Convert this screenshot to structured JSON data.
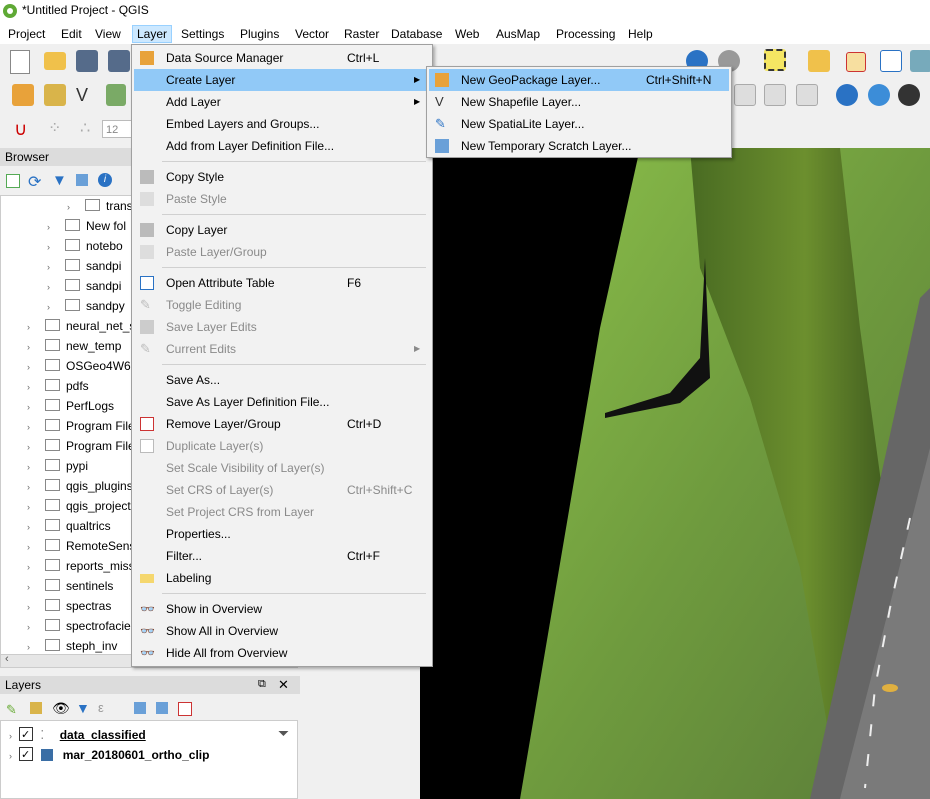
{
  "window": {
    "title": "*Untitled Project - QGIS"
  },
  "menubar": [
    "Project",
    "Edit",
    "View",
    "Layer",
    "Settings",
    "Plugins",
    "Vector",
    "Raster",
    "Database",
    "Web",
    "AusMap",
    "Processing",
    "Help"
  ],
  "toolbar": {
    "scale_value": "12"
  },
  "browser": {
    "title": "Browser",
    "items": [
      "trans",
      "New fol",
      "notebo",
      "sandpi",
      "sandpi",
      "sandpy",
      "neural_net_s",
      "new_temp",
      "OSGeo4W64",
      "pdfs",
      "PerfLogs",
      "Program File",
      "Program File",
      "pypi",
      "qgis_plugins",
      "qgis_project",
      "qualtrics",
      "RemoteSens",
      "reports_miss",
      "sentinels",
      "spectras",
      "spectrofacie",
      "steph_inv"
    ]
  },
  "layers": {
    "title": "Layers",
    "items": [
      "data_classified",
      "mar_20180601_ortho_clip"
    ]
  },
  "layer_menu": {
    "items": [
      {
        "label": "Data Source Manager",
        "shortcut": "Ctrl+L"
      },
      {
        "label": "Create Layer",
        "shortcut": ""
      },
      {
        "label": "Add Layer",
        "shortcut": ""
      },
      {
        "label": "Embed Layers and Groups...",
        "shortcut": ""
      },
      {
        "label": "Add from Layer Definition File...",
        "shortcut": ""
      },
      {
        "label": "Copy Style",
        "shortcut": ""
      },
      {
        "label": "Paste Style",
        "shortcut": ""
      },
      {
        "label": "Copy Layer",
        "shortcut": ""
      },
      {
        "label": "Paste Layer/Group",
        "shortcut": ""
      },
      {
        "label": "Open Attribute Table",
        "shortcut": "F6"
      },
      {
        "label": "Toggle Editing",
        "shortcut": ""
      },
      {
        "label": "Save Layer Edits",
        "shortcut": ""
      },
      {
        "label": "Current Edits",
        "shortcut": ""
      },
      {
        "label": "Save As...",
        "shortcut": ""
      },
      {
        "label": "Save As Layer Definition File...",
        "shortcut": ""
      },
      {
        "label": "Remove Layer/Group",
        "shortcut": "Ctrl+D"
      },
      {
        "label": "Duplicate Layer(s)",
        "shortcut": ""
      },
      {
        "label": "Set Scale Visibility of Layer(s)",
        "shortcut": ""
      },
      {
        "label": "Set CRS of Layer(s)",
        "shortcut": "Ctrl+Shift+C"
      },
      {
        "label": "Set Project CRS from Layer",
        "shortcut": ""
      },
      {
        "label": "Properties...",
        "shortcut": ""
      },
      {
        "label": "Filter...",
        "shortcut": "Ctrl+F"
      },
      {
        "label": "Labeling",
        "shortcut": ""
      },
      {
        "label": "Show in Overview",
        "shortcut": ""
      },
      {
        "label": "Show All in Overview",
        "shortcut": ""
      },
      {
        "label": "Hide All from Overview",
        "shortcut": ""
      }
    ]
  },
  "create_layer_menu": {
    "items": [
      {
        "label": "New GeoPackage Layer...",
        "shortcut": "Ctrl+Shift+N"
      },
      {
        "label": "New Shapefile Layer...",
        "shortcut": ""
      },
      {
        "label": "New SpatiaLite Layer...",
        "shortcut": ""
      },
      {
        "label": "New Temporary Scratch Layer...",
        "shortcut": ""
      }
    ]
  },
  "colors": {
    "highlight": "#91c9f7",
    "menu_active": "#cce8ff",
    "qgis_green": "#5fa935"
  }
}
